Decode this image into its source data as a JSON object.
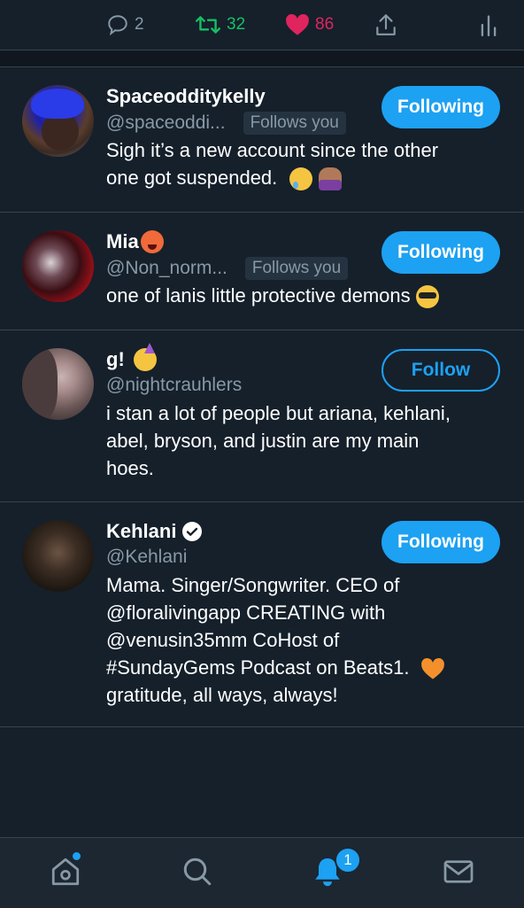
{
  "tweet_actions": {
    "replies": "2",
    "retweets": "32",
    "likes": "86"
  },
  "users": [
    {
      "name": "Spaceodditykelly",
      "handle": "@spaceoddi...",
      "follows_you": "Follows you",
      "button": "Following",
      "bio_lines": [
        "Sigh it’s a new account since the other",
        "one got suspended."
      ]
    },
    {
      "name": "Mia",
      "handle": "@Non_norm...",
      "follows_you": "Follows you",
      "button": "Following",
      "bio_lines": [
        "one of lanis little protective demons"
      ]
    },
    {
      "name": "g!",
      "handle": "@nightcrauhlers",
      "button": "Follow",
      "bio_lines": [
        "i stan a lot of people but ariana, kehlani,",
        "abel, bryson, and justin are my main",
        "hoes."
      ]
    },
    {
      "name": "Kehlani",
      "handle": "@Kehlani",
      "button": "Following",
      "bio_lines": [
        "Mama. Singer/Songwriter. CEO of",
        "@floralivingapp CREATING with",
        "@venusin35mm CoHost of",
        "#SundayGems Podcast on Beats1.",
        "gratitude, all ways, always!"
      ]
    }
  ],
  "tabbar": {
    "notifications_badge": "1"
  },
  "colors": {
    "accent": "#1da1f2",
    "retweet": "#17bf63",
    "like": "#e0245e",
    "background": "#15202b"
  }
}
